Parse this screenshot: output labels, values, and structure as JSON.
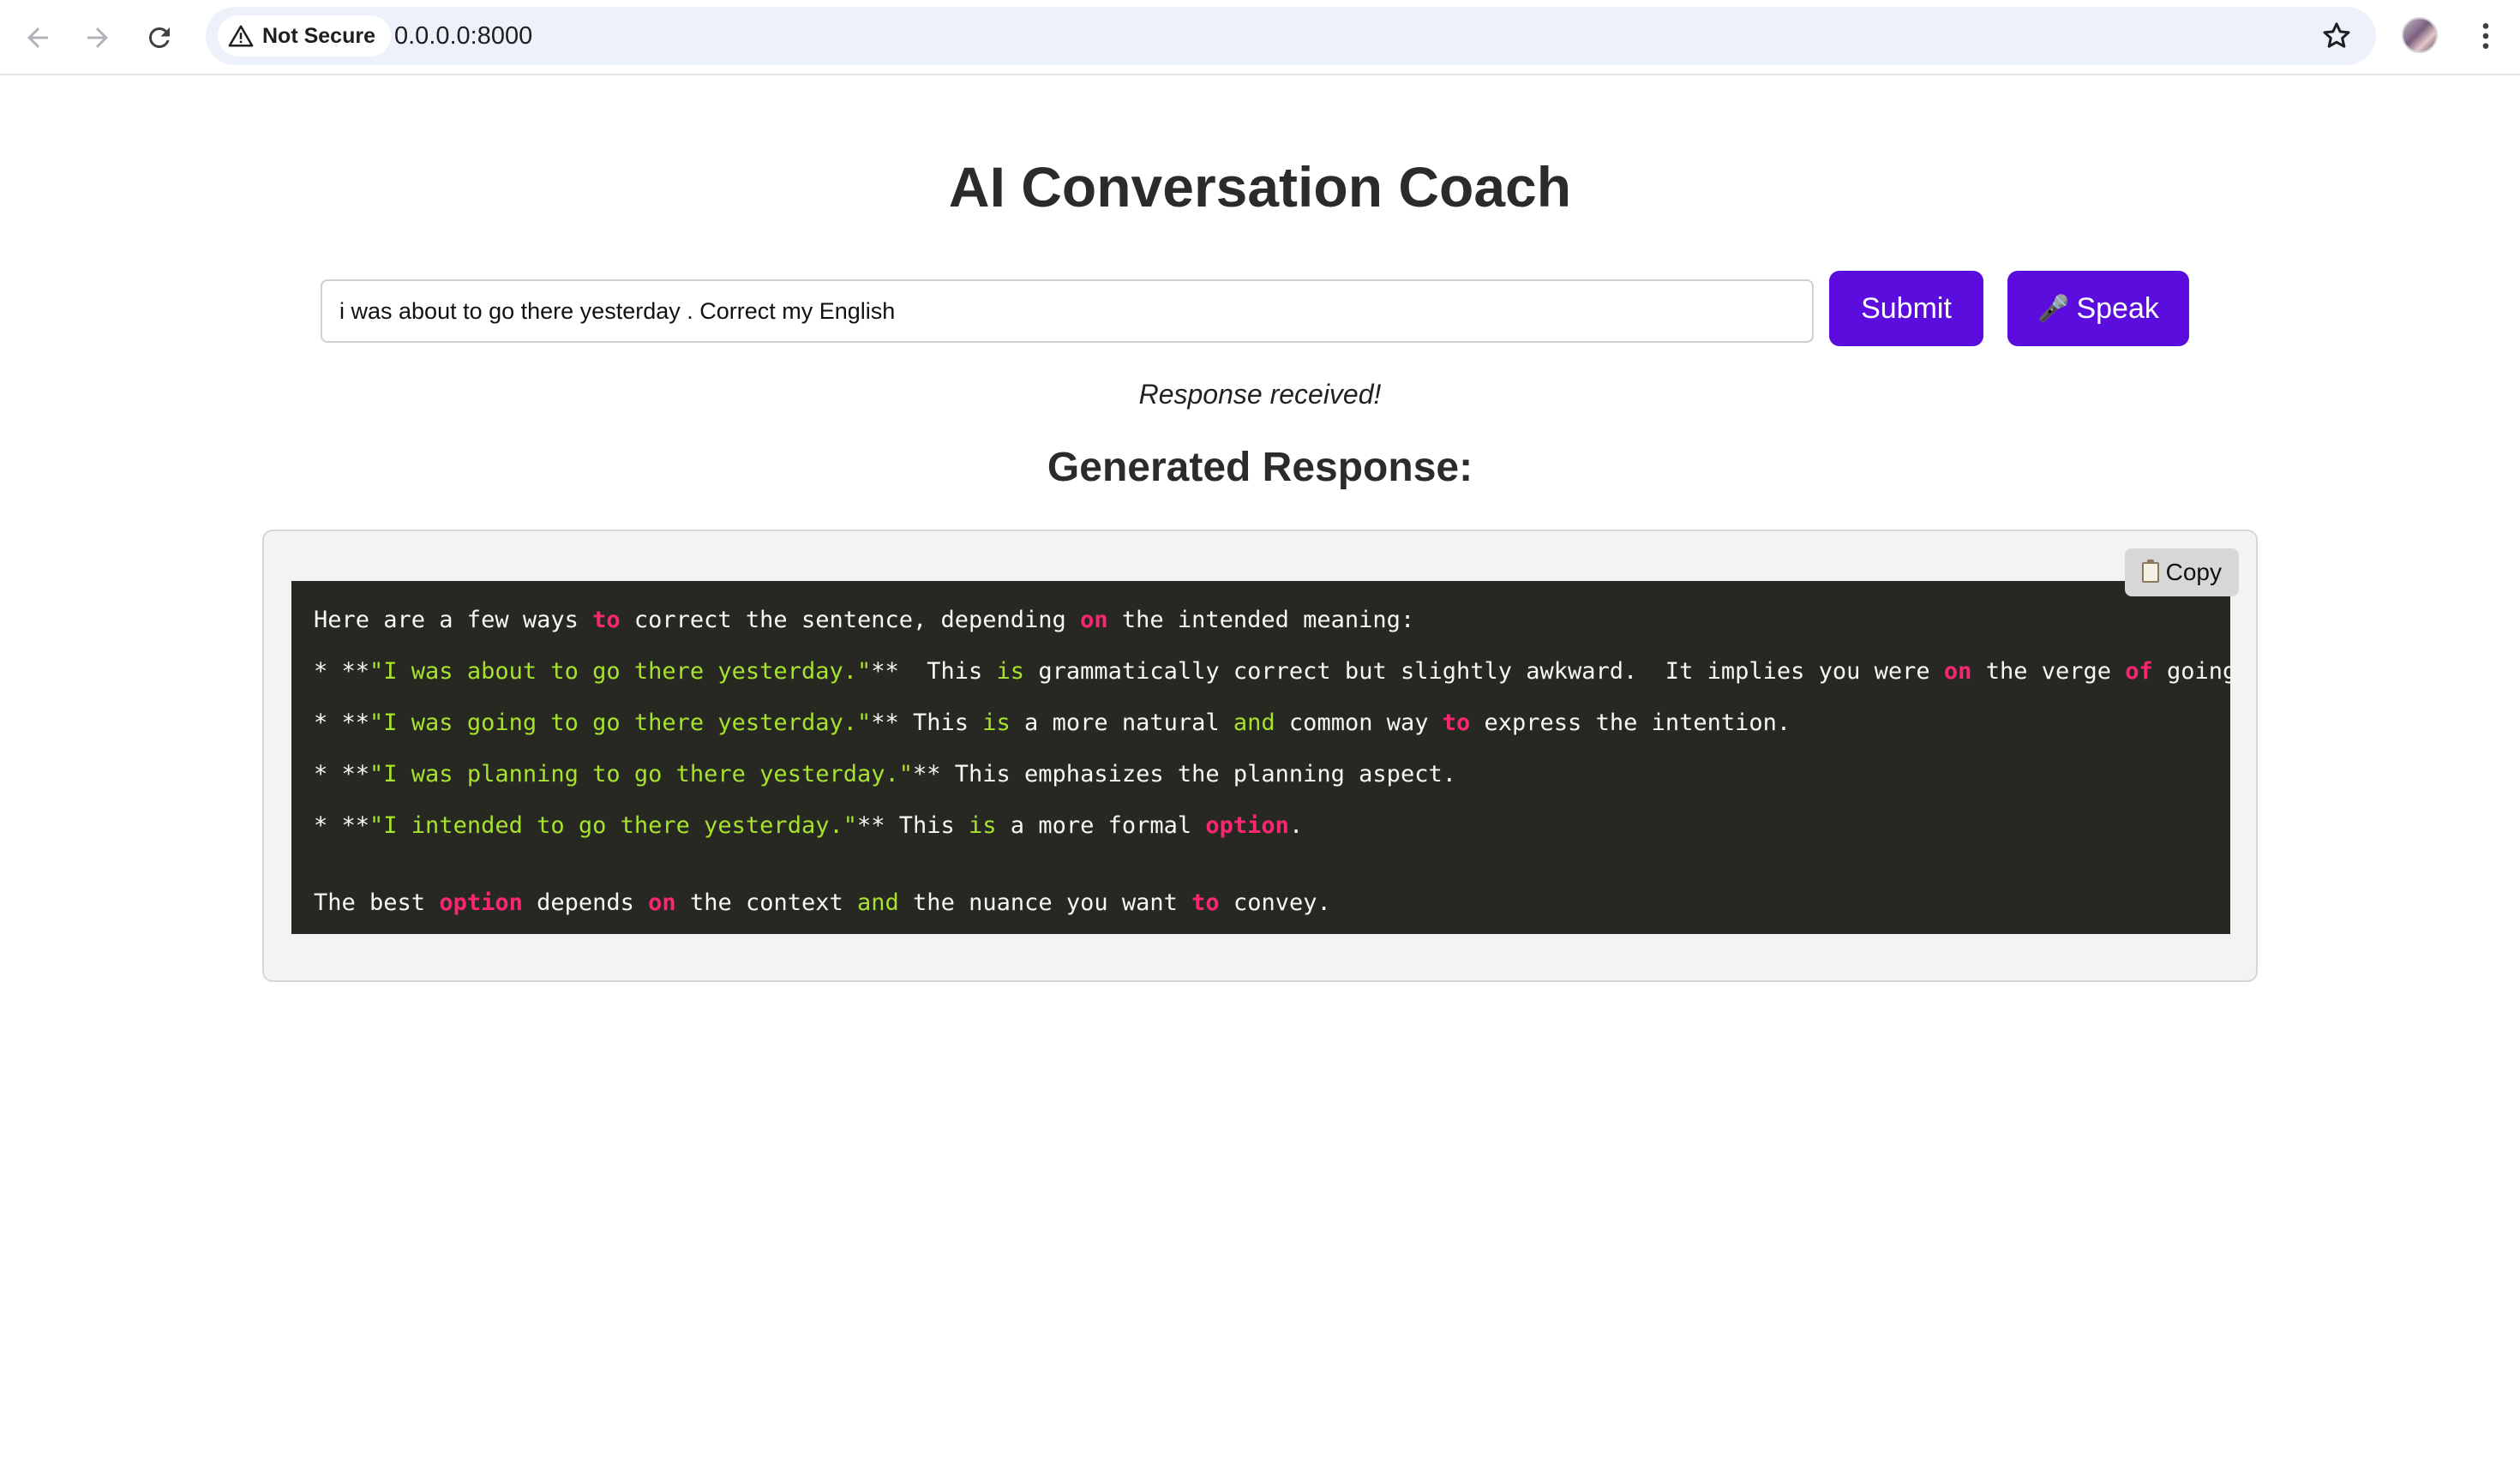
{
  "browser": {
    "security_label": "Not Secure",
    "url": "0.0.0.0:8000"
  },
  "page": {
    "title": "AI Conversation Coach",
    "input_value": "i was about to go there yesterday . Correct my English",
    "submit_label": "Submit",
    "speak_icon": "🎤",
    "speak_label": "Speak",
    "status": "Response received!",
    "response_heading": "Generated Response:",
    "copy_icon": "clipboard-icon",
    "copy_label": "Copy"
  },
  "response": {
    "lines": [
      [
        {
          "t": "Here are a few ways ",
          "c": ""
        },
        {
          "t": "to",
          "c": "kw"
        },
        {
          "t": " correct the sentence, depending ",
          "c": ""
        },
        {
          "t": "on",
          "c": "kw"
        },
        {
          "t": " the intended meaning:",
          "c": ""
        }
      ],
      [
        {
          "t": "* **",
          "c": ""
        },
        {
          "t": "\"I was about to go there yesterday.\"",
          "c": "str"
        },
        {
          "t": "**  This ",
          "c": ""
        },
        {
          "t": "is",
          "c": "kw2"
        },
        {
          "t": " grammatically correct but slightly awkward.  It implies you were ",
          "c": ""
        },
        {
          "t": "on",
          "c": "kw"
        },
        {
          "t": " the verge ",
          "c": ""
        },
        {
          "t": "of",
          "c": "kw"
        },
        {
          "t": " going yest",
          "c": ""
        }
      ],
      [
        {
          "t": "* **",
          "c": ""
        },
        {
          "t": "\"I was going to go there yesterday.\"",
          "c": "str"
        },
        {
          "t": "** This ",
          "c": ""
        },
        {
          "t": "is",
          "c": "kw2"
        },
        {
          "t": " a more natural ",
          "c": ""
        },
        {
          "t": "and",
          "c": "kw2"
        },
        {
          "t": " common way ",
          "c": ""
        },
        {
          "t": "to",
          "c": "kw"
        },
        {
          "t": " express the intention.",
          "c": ""
        }
      ],
      [
        {
          "t": "* **",
          "c": ""
        },
        {
          "t": "\"I was planning to go there yesterday.\"",
          "c": "str"
        },
        {
          "t": "** This emphasizes the planning aspect.",
          "c": ""
        }
      ],
      [
        {
          "t": "* **",
          "c": ""
        },
        {
          "t": "\"I intended to go there yesterday.\"",
          "c": "str"
        },
        {
          "t": "** This ",
          "c": ""
        },
        {
          "t": "is",
          "c": "kw2"
        },
        {
          "t": " a more formal ",
          "c": ""
        },
        {
          "t": "option",
          "c": "kw"
        },
        {
          "t": ".",
          "c": ""
        }
      ],
      [],
      [
        {
          "t": "The best ",
          "c": ""
        },
        {
          "t": "option",
          "c": "kw"
        },
        {
          "t": " depends ",
          "c": ""
        },
        {
          "t": "on",
          "c": "kw"
        },
        {
          "t": " the context ",
          "c": ""
        },
        {
          "t": "and",
          "c": "kw2"
        },
        {
          "t": " the nuance you want ",
          "c": ""
        },
        {
          "t": "to",
          "c": "kw"
        },
        {
          "t": " convey.",
          "c": ""
        }
      ]
    ]
  },
  "colors": {
    "accent": "#5b0ddd",
    "code_background": "#272822",
    "keyword": "#f92672",
    "string": "#a6e22e"
  }
}
